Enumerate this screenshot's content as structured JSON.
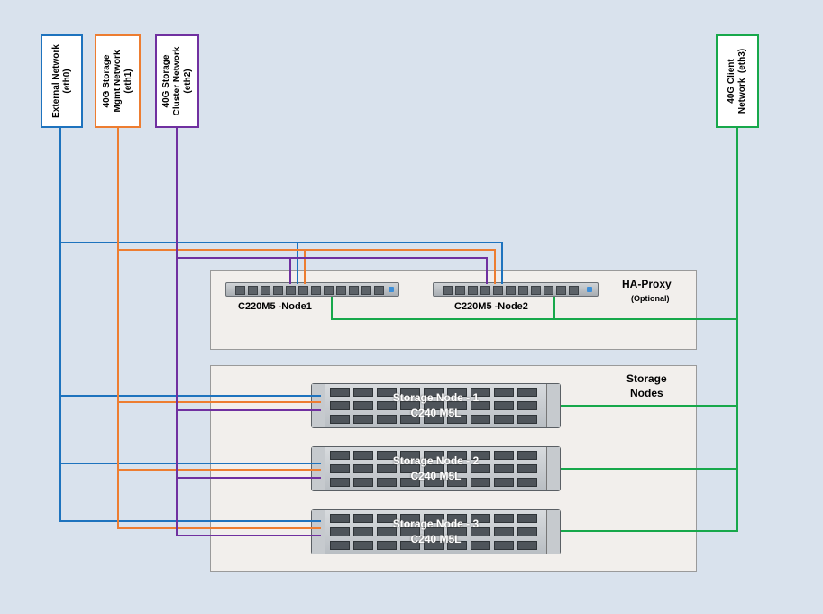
{
  "networks": [
    {
      "id": "eth0",
      "label": "External Network\n(eth0)",
      "color": "#1e73be"
    },
    {
      "id": "eth1",
      "label": "40G Storage\nMgmt Network\n(eth1)",
      "color": "#ed7d31"
    },
    {
      "id": "eth2",
      "label": "40G Storage\nCluster Network\n(eth2)",
      "color": "#7030a0"
    },
    {
      "id": "eth3",
      "label": "40G Client\nNetwork  (eth3)",
      "color": "#17a84b"
    }
  ],
  "ha_proxy": {
    "title": "HA-Proxy",
    "subtitle": "(Optional)",
    "nodes": [
      "C220M5 -Node1",
      "C220M5 -Node2"
    ]
  },
  "storage": {
    "title": "Storage\nNodes",
    "nodes": [
      {
        "name": "Storage Node - 1",
        "model": "C240 M5L"
      },
      {
        "name": "Storage Node - 2",
        "model": "C240 M5L"
      },
      {
        "name": "Storage Node - 3",
        "model": "C240 M5L"
      }
    ]
  },
  "colors": {
    "background": "#d9e2ed",
    "group_fill": "#f2efec",
    "server_chassis": "#c4c8cc"
  }
}
